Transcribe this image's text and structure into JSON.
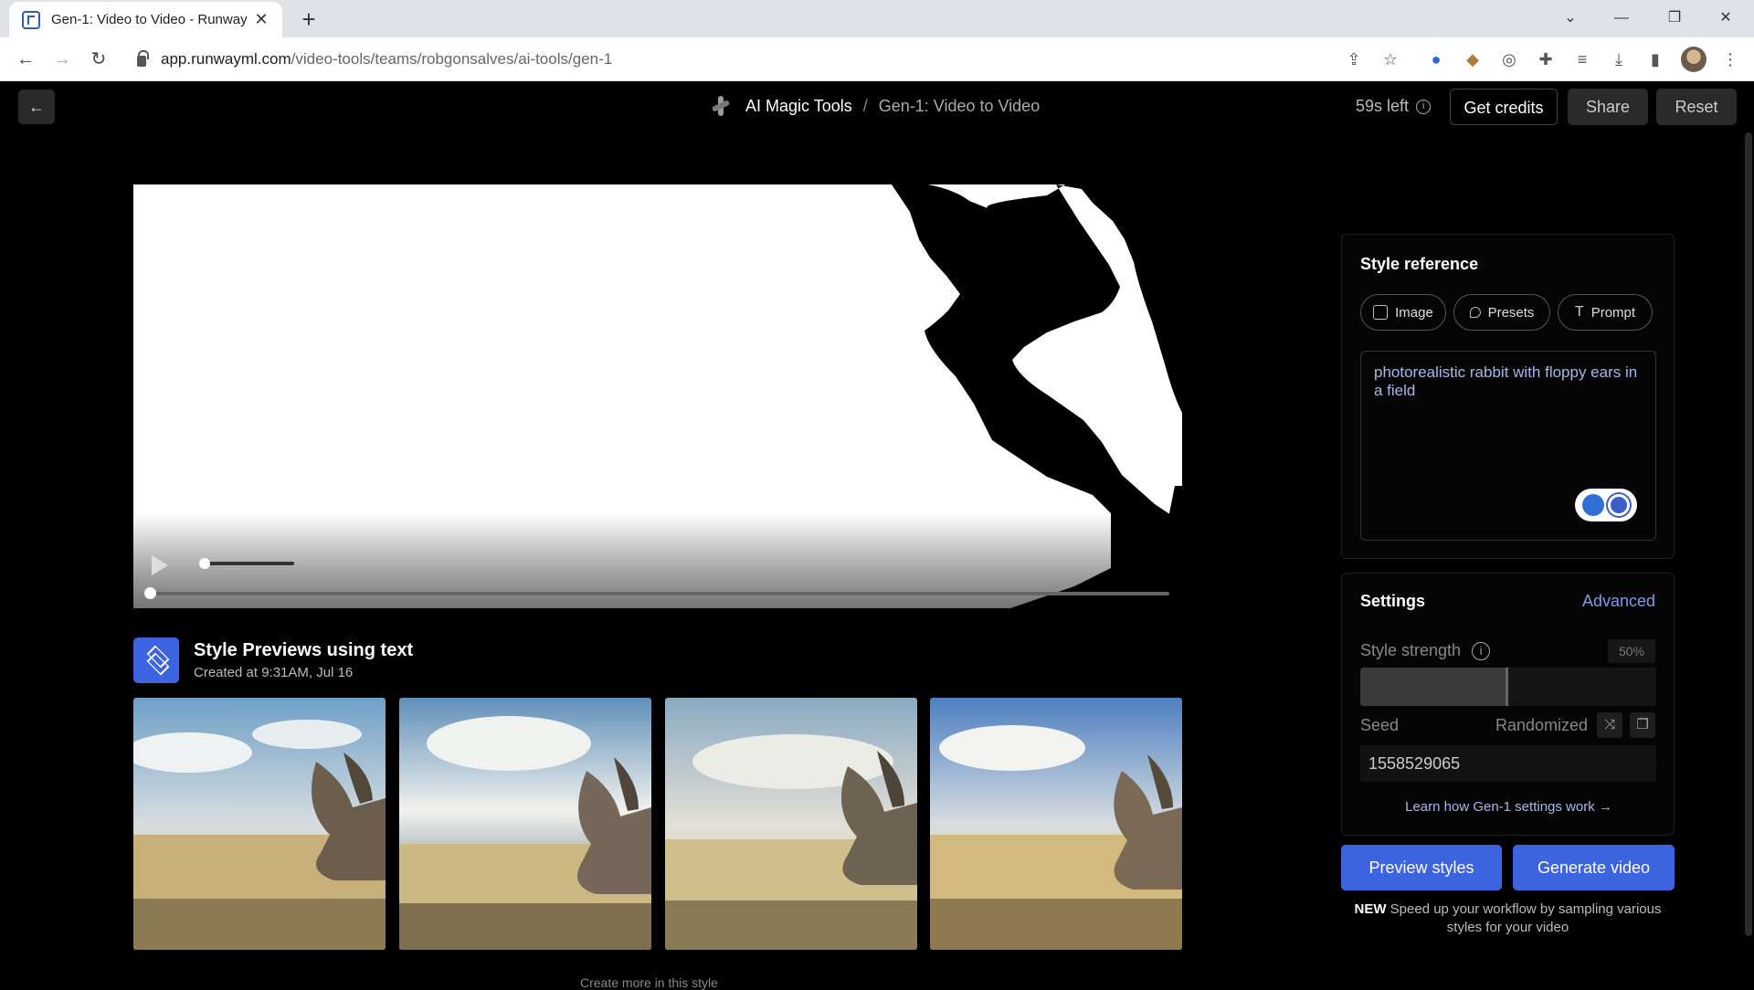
{
  "browser": {
    "tab_title": "Gen-1: Video to Video - Runway",
    "url_host": "app.runwayml.com",
    "url_path": "/video-tools/teams/robgonsalves/ai-tools/gen-1"
  },
  "header": {
    "breadcrumb_root": "AI Magic Tools",
    "breadcrumb_sep": "/",
    "breadcrumb_leaf": "Gen-1: Video to Video",
    "time_left": "59s left",
    "get_credits": "Get credits",
    "share": "Share",
    "reset": "Reset"
  },
  "video": {
    "playing": false
  },
  "previews": {
    "title": "Style Previews using text",
    "created": "Created at 9:31AM, Jul 16",
    "more_label": "Create more in this style",
    "thumbnails": [
      "preview-1",
      "preview-2",
      "preview-3",
      "preview-4"
    ]
  },
  "style_reference": {
    "title": "Style reference",
    "tabs": [
      "Image",
      "Presets",
      "Prompt"
    ],
    "prompt_text": "photorealistic rabbit with floppy ears in a field"
  },
  "settings": {
    "title": "Settings",
    "advanced": "Advanced",
    "style_strength_label": "Style strength",
    "style_strength_value": "50%",
    "style_strength_fraction": 0.5,
    "seed_label": "Seed",
    "randomized_label": "Randomized",
    "seed_value": "1558529065",
    "learn_link": "Learn how Gen-1 settings work →"
  },
  "actions": {
    "preview_styles": "Preview styles",
    "generate_video": "Generate video",
    "new_badge": "NEW",
    "new_note": "Speed up your workflow by sampling various styles for your video"
  },
  "colors": {
    "accent": "#3c63e0",
    "link": "#7f99ea"
  }
}
